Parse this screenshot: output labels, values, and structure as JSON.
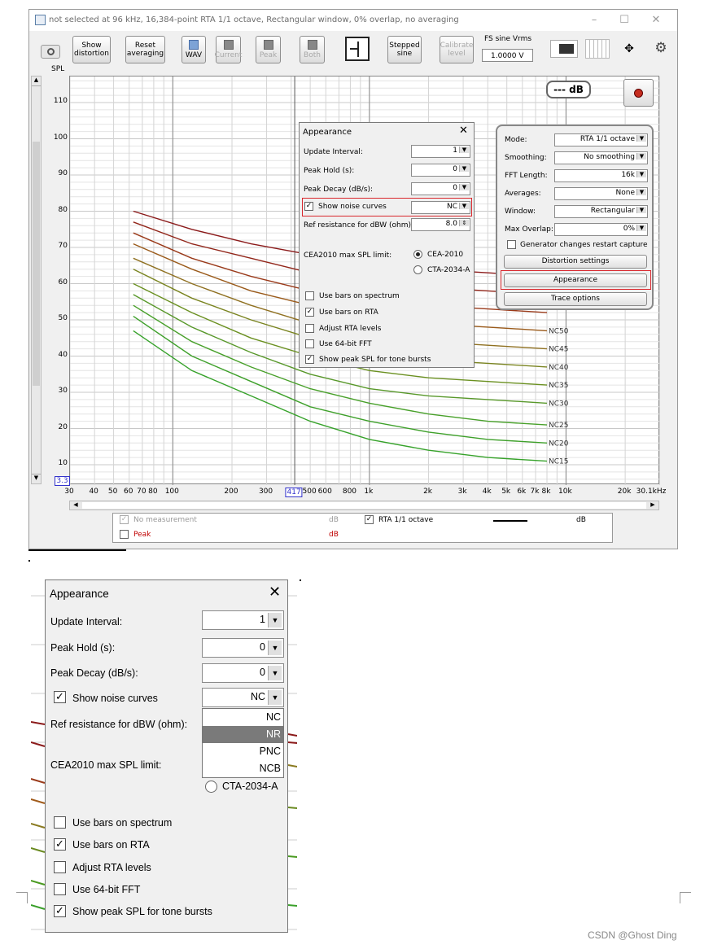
{
  "window": {
    "title": "not selected at 96 kHz, 16,384-point RTA 1/1 octave, Rectangular window, 0% overlap, no averaging",
    "controls": [
      "–",
      "☐",
      "✕"
    ]
  },
  "toolbar": {
    "show_distortion": "Show distortion",
    "reset_averaging": "Reset averaging",
    "wav": "WAV",
    "current": "Current",
    "peak": "Peak",
    "both": "Both",
    "stepped_sine": "Stepped sine",
    "calibrate_level": "Calibrate level",
    "fs_sine_label": "FS sine Vrms",
    "fs_sine_value": "1.0000 V"
  },
  "plot": {
    "y_axis_title": "SPL",
    "y_ticks": [
      "110",
      "100",
      "90",
      "80",
      "70",
      "60",
      "50",
      "40",
      "30",
      "20",
      "10"
    ],
    "y_bottom_value": "3.3",
    "x_ticks": [
      "30",
      "40",
      "50",
      "60",
      "70",
      "80",
      "100",
      "200",
      "300",
      "500",
      "600",
      "800",
      "1k",
      "2k",
      "3k",
      "4k",
      "5k",
      "6k",
      "7k",
      "8k",
      "10k",
      "20k",
      "30.1kHz"
    ],
    "cursor_x_value": "417",
    "level_readout": "--- dB",
    "curve_labels": [
      "NC50",
      "NC45",
      "NC40",
      "NC35",
      "NC30",
      "NC25",
      "NC20",
      "NC15"
    ]
  },
  "rta_panel": {
    "mode_label": "Mode:",
    "mode_value": "RTA 1/1 octave",
    "smoothing_label": "Smoothing:",
    "smoothing_value": "No smoothing",
    "fft_label": "FFT Length:",
    "fft_value": "16k",
    "averages_label": "Averages:",
    "averages_value": "None",
    "window_label": "Window:",
    "window_value": "Rectangular",
    "overlap_label": "Max Overlap:",
    "overlap_value": "0%",
    "generator_restart": "Generator changes restart capture",
    "distortion_settings": "Distortion settings",
    "appearance": "Appearance",
    "trace_options": "Trace options"
  },
  "appearance": {
    "title": "Appearance",
    "update_interval_label": "Update Interval:",
    "update_interval_value": "1",
    "peak_hold_label": "Peak Hold (s):",
    "peak_hold_value": "0",
    "peak_decay_label": "Peak Decay (dB/s):",
    "peak_decay_value": "0",
    "noise_curves_label": "Show noise curves",
    "noise_curves_value": "NC",
    "ref_resistance_label": "Ref resistance for dBW (ohm):",
    "ref_resistance_value": "8.0",
    "cea_label": "CEA2010 max SPL limit:",
    "cea_option_1": "CEA-2010",
    "cea_option_2": "CTA-2034-A",
    "use_bars_spectrum": "Use bars on spectrum",
    "use_bars_rta": "Use bars on RTA",
    "adjust_rta": "Adjust RTA levels",
    "use_64bit": "Use 64-bit FFT",
    "show_peak_spl": "Show peak SPL for tone bursts",
    "dropdown_options": [
      "NC",
      "NR",
      "PNC",
      "NCB"
    ],
    "dropdown_selected": "NR"
  },
  "legend": {
    "no_measurement": "No measurement",
    "no_measurement_unit": "dB",
    "rta": "RTA 1/1 octave",
    "rta_unit": "dB",
    "peak": "Peak",
    "peak_unit": "dB"
  },
  "watermark": "CSDN @Ghost Ding",
  "colors": {
    "highlight": "#d9262c",
    "peak_text": "#c00000",
    "nc_top": "#8b1a1a",
    "nc_bottom": "#3aa02a"
  }
}
